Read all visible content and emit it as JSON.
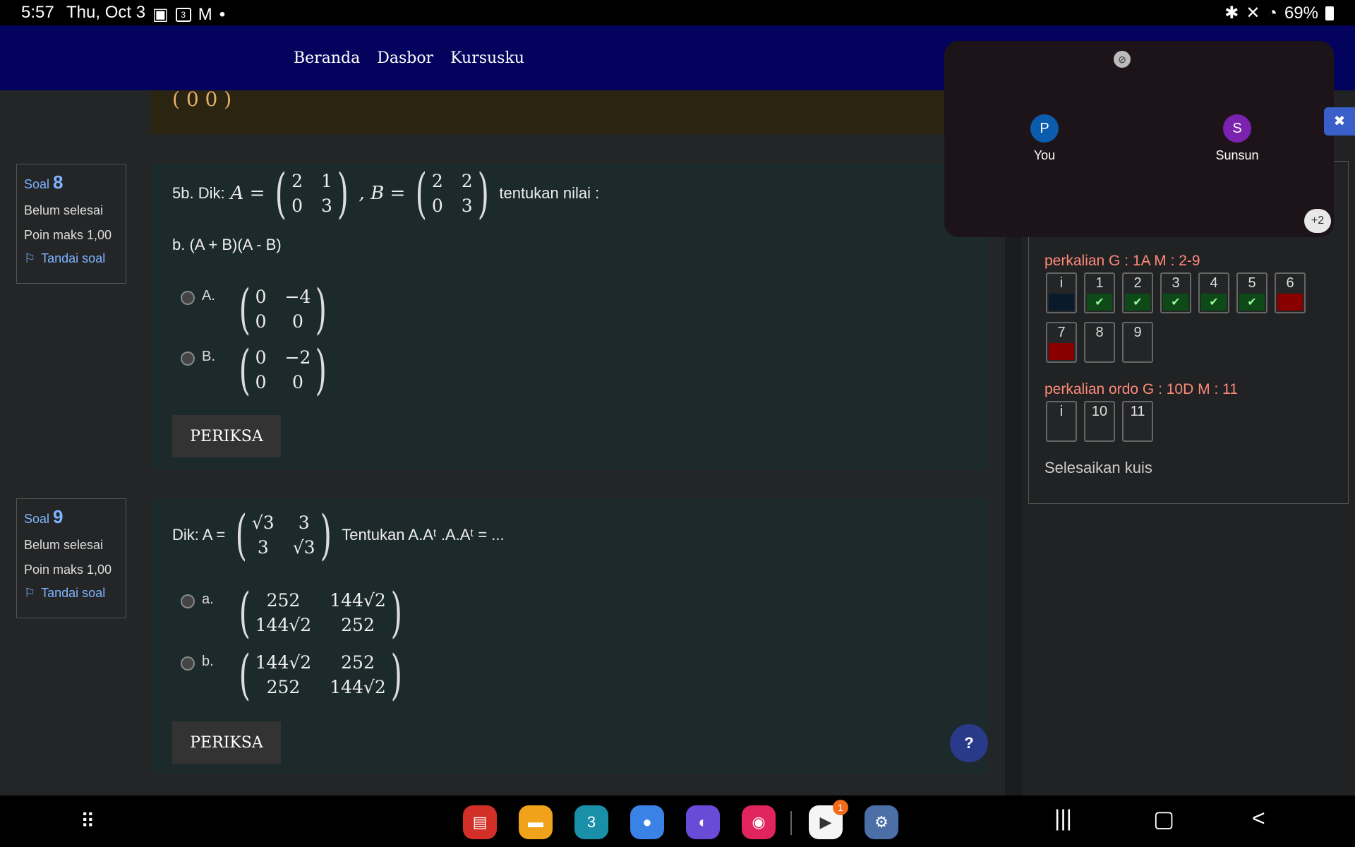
{
  "status": {
    "time": "5:57",
    "date": "Thu, Oct 3",
    "battery": "69%",
    "calendar_badge": "3"
  },
  "nav": {
    "links": [
      "Beranda",
      "Dasbor",
      "Kursusku"
    ]
  },
  "prev_matrix_row": "0   0",
  "q8": {
    "soal_label": "Soal",
    "number": "8",
    "status": "Belum selesai",
    "points": "Poin maks 1,00",
    "flag": "Tandai soal",
    "prefix": "5b. Dik:",
    "a_label": "A =",
    "b_label": ", B =",
    "A": [
      "2",
      "1",
      "0",
      "3"
    ],
    "B": [
      "2",
      "2",
      "0",
      "3"
    ],
    "suffix": "tentukan nilai :",
    "sub": "b. (A + B)(A - B)",
    "options": [
      {
        "label": "A.",
        "matrix": [
          "0",
          "−4",
          "0",
          "0"
        ]
      },
      {
        "label": "B.",
        "matrix": [
          "0",
          "−2",
          "0",
          "0"
        ]
      }
    ],
    "check": "PERIKSA"
  },
  "q9": {
    "soal_label": "Soal",
    "number": "9",
    "status": "Belum selesai",
    "points": "Poin maks 1,00",
    "flag": "Tandai soal",
    "prefix": "Dik: A =",
    "A": [
      "√3",
      "3",
      "3",
      "√3"
    ],
    "suffix": "Tentukan A.Aᵗ .A.Aᵗ = ...",
    "options": [
      {
        "label": "a.",
        "matrix": [
          "252",
          "144√2",
          "144√2",
          "252"
        ]
      },
      {
        "label": "b.",
        "matrix": [
          "144√2",
          "252",
          "252",
          "144√2"
        ]
      }
    ],
    "check": "PERIKSA"
  },
  "quiz_nav": {
    "section1": "perkalian G : 1A M : 2-9",
    "section1_items": [
      {
        "label": "i",
        "state": "info"
      },
      {
        "label": "1",
        "state": "done"
      },
      {
        "label": "2",
        "state": "done"
      },
      {
        "label": "3",
        "state": "done"
      },
      {
        "label": "4",
        "state": "done"
      },
      {
        "label": "5",
        "state": "done"
      },
      {
        "label": "6",
        "state": "wrong"
      },
      {
        "label": "7",
        "state": "wrong"
      },
      {
        "label": "8",
        "state": "empty"
      },
      {
        "label": "9",
        "state": "empty"
      }
    ],
    "section2": "perkalian ordo G : 10D M : 11",
    "section2_items": [
      {
        "label": "i",
        "state": "empty"
      },
      {
        "label": "10",
        "state": "empty"
      },
      {
        "label": "11",
        "state": "empty"
      }
    ],
    "finish": "Selesaikan kuis"
  },
  "call": {
    "participants": [
      {
        "initial": "P",
        "name": "You",
        "color": "#0b5cad"
      },
      {
        "initial": "S",
        "name": "Sunsun",
        "color": "#7b22b0"
      }
    ],
    "more": "+2"
  },
  "help": "?",
  "dock": {
    "apps": [
      "notes",
      "files",
      "calendar",
      "messages",
      "internet",
      "camera",
      "meet",
      "settings"
    ],
    "calendar_day": "3",
    "meet_badge": "1"
  }
}
